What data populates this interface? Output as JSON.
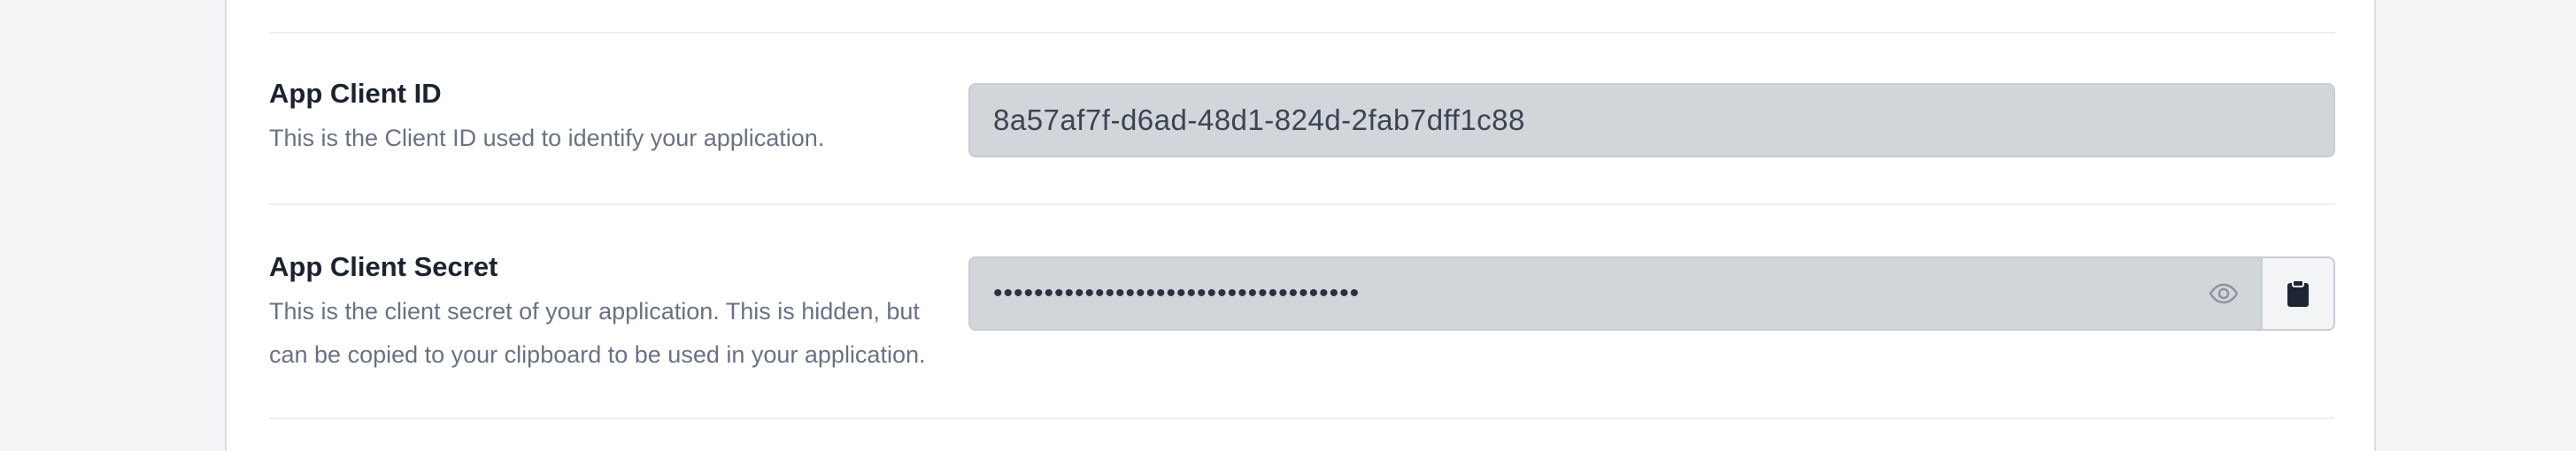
{
  "app_client_id": {
    "title": "App Client ID",
    "description": "This is the Client ID used to identify your application.",
    "value": "8a57af7f-d6ad-48d1-824d-2fab7dff1c88"
  },
  "app_client_secret": {
    "title": "App Client Secret",
    "description_line1": "This is the client secret of your application. This is hidden, but",
    "description_line2": "can be copied to your clipboard to be used in your application.",
    "masked_value": "••••••••••••••••••••••••••••••••••••",
    "reveal_icon": "eye-icon",
    "copy_icon": "clipboard-icon"
  },
  "colors": {
    "field_background": "#d2d5da",
    "label_text": "#1b2330",
    "description_text": "#687285"
  }
}
